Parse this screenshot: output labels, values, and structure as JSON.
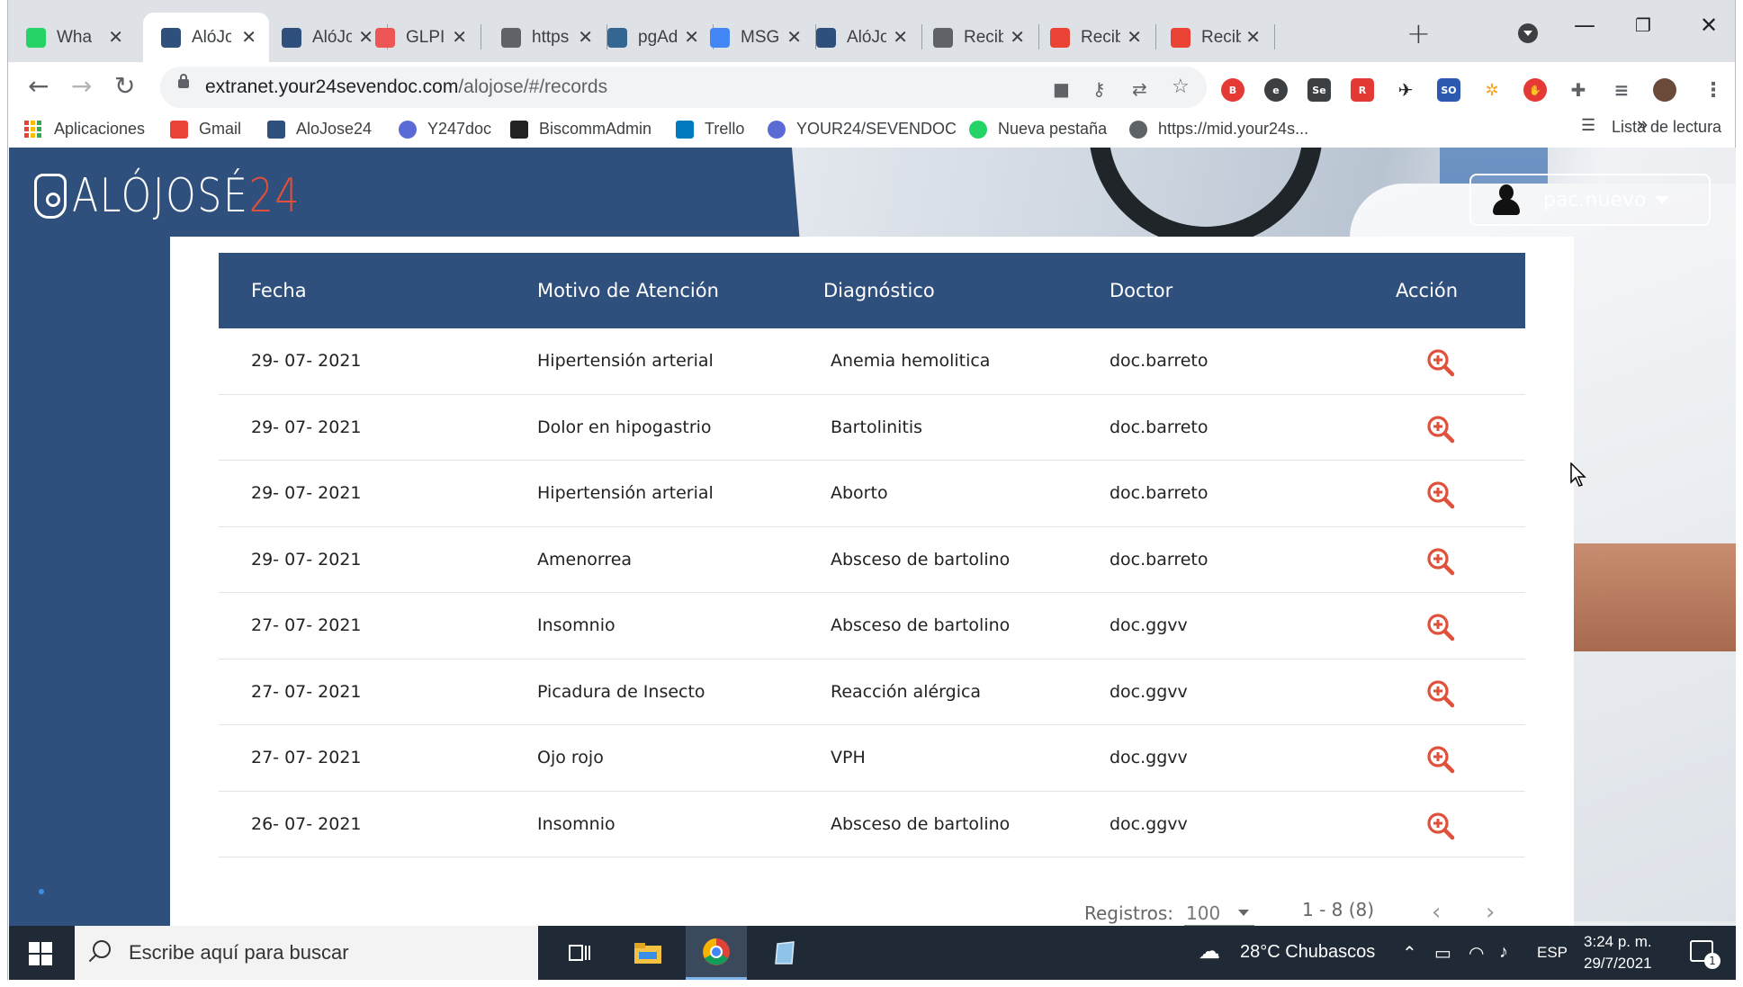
{
  "browser": {
    "tabs": [
      {
        "label": "Wha",
        "favicon": "whatsapp-icon",
        "color": "#25d366"
      },
      {
        "label": "AlóJo",
        "favicon": "alojose-icon",
        "color": "#2f4f7c",
        "active": true
      },
      {
        "label": "AlóJo",
        "favicon": "alojose-icon",
        "color": "#2f4f7c"
      },
      {
        "label": "GLPI",
        "favicon": "glpi-icon",
        "color": "#e55"
      },
      {
        "label": "https",
        "favicon": "globe-icon",
        "color": "#5f6368"
      },
      {
        "label": "pgAd",
        "favicon": "pgadmin-icon",
        "color": "#336791"
      },
      {
        "label": "MSG",
        "favicon": "docs-icon",
        "color": "#4285f4"
      },
      {
        "label": "AlóJo",
        "favicon": "alojose-icon",
        "color": "#2f4f7c"
      },
      {
        "label": "Recib",
        "favicon": "globe-icon",
        "color": "#5f6368"
      },
      {
        "label": "Recib",
        "favicon": "gmail-icon",
        "color": "#ea4335"
      },
      {
        "label": "Recib",
        "favicon": "gmail-icon",
        "color": "#ea4335"
      }
    ],
    "url_host": "extranet.your24sevendoc.com",
    "url_path": "/alojose/#/records",
    "bookmarks": [
      {
        "label": "Aplicaciones",
        "icon": "apps-icon"
      },
      {
        "label": "Gmail",
        "icon": "gmail-icon",
        "color": "#ea4335"
      },
      {
        "label": "AloJose24",
        "icon": "alojose-icon",
        "color": "#2f4f7c"
      },
      {
        "label": "Y247doc",
        "icon": "y247doc-icon",
        "color": "#5b6bd6"
      },
      {
        "label": "BiscommAdmin",
        "icon": "angular-icon",
        "color": "#222"
      },
      {
        "label": "Trello",
        "icon": "trello-icon",
        "color": "#0079bf"
      },
      {
        "label": "YOUR24/SEVENDOC",
        "icon": "y247doc-icon",
        "color": "#5b6bd6"
      },
      {
        "label": "Nueva pestaña",
        "icon": "whatsapp-icon",
        "color": "#25d366"
      },
      {
        "label": "https://mid.your24s...",
        "icon": "globe-icon",
        "color": "#5f6368"
      }
    ],
    "more_bookmarks": "»",
    "reading_list": "Lista de lectura"
  },
  "app": {
    "logo_text": "ALÓJOSÉ",
    "logo_num": "24",
    "user": "pac.nuevo"
  },
  "table": {
    "headers": [
      "Fecha",
      "Motivo de Atención",
      "Diagnóstico",
      "Doctor",
      "Acción"
    ],
    "rows": [
      {
        "fecha": "29- 07- 2021",
        "motivo": "Hipertensión arterial",
        "diagnostico": "Anemia hemolitica",
        "doctor": "doc.barreto"
      },
      {
        "fecha": "29- 07- 2021",
        "motivo": "Dolor en hipogastrio",
        "diagnostico": "Bartolinitis",
        "doctor": "doc.barreto"
      },
      {
        "fecha": "29- 07- 2021",
        "motivo": "Hipertensión arterial",
        "diagnostico": "Aborto",
        "doctor": "doc.barreto"
      },
      {
        "fecha": "29- 07- 2021",
        "motivo": "Amenorrea",
        "diagnostico": "Absceso de bartolino",
        "doctor": "doc.barreto"
      },
      {
        "fecha": "27- 07- 2021",
        "motivo": "Insomnio",
        "diagnostico": "Absceso de bartolino",
        "doctor": "doc.ggvv"
      },
      {
        "fecha": "27- 07- 2021",
        "motivo": "Picadura de Insecto",
        "diagnostico": "Reacción alérgica",
        "doctor": "doc.ggvv"
      },
      {
        "fecha": "27- 07- 2021",
        "motivo": "Ojo rojo",
        "diagnostico": "VPH",
        "doctor": "doc.ggvv"
      },
      {
        "fecha": "26- 07- 2021",
        "motivo": "Insomnio",
        "diagnostico": "Absceso de bartolino",
        "doctor": "doc.ggvv"
      }
    ],
    "action_icon": "zoom-in-icon",
    "action_color": "#e0503a"
  },
  "pager": {
    "label": "Registros:",
    "page_size": "100",
    "range": "1 - 8 (8)",
    "prev": "‹",
    "next": "›"
  },
  "taskbar": {
    "search_placeholder": "Escribe aquí para buscar",
    "weather": "28°C  Chubascos",
    "lang": "ESP",
    "time": "3:24 p. m.",
    "date": "29/7/2021",
    "notifications": "1"
  },
  "colors": {
    "brand": "#2f4f7c",
    "accent": "#e0503a"
  }
}
